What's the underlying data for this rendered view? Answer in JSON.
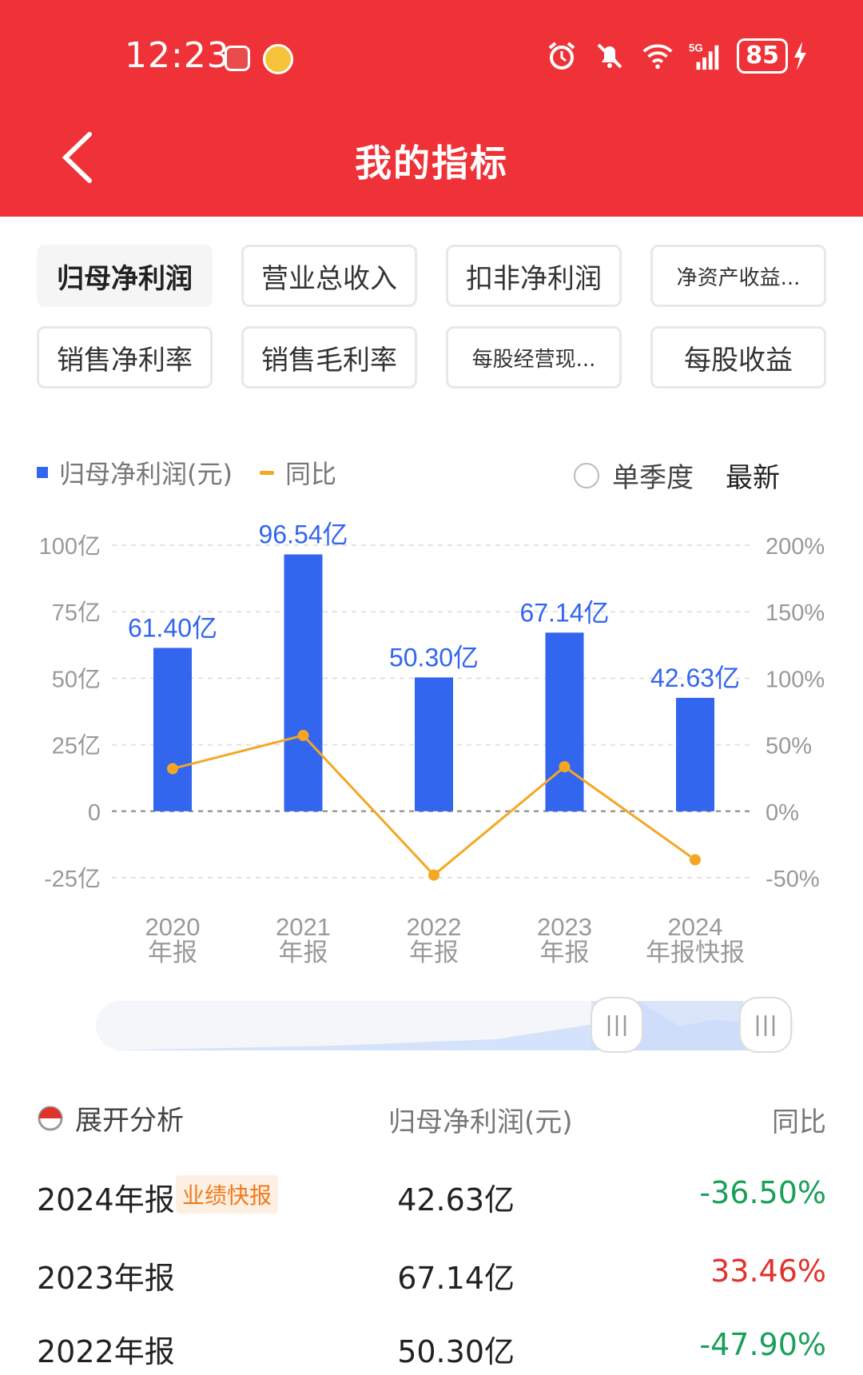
{
  "status_bar": {
    "time": "12:23",
    "battery": "85"
  },
  "header": {
    "title": "我的指标"
  },
  "metric_chips": [
    {
      "label": "归母净利润",
      "active": true
    },
    {
      "label": "营业总收入",
      "active": false
    },
    {
      "label": "扣非净利润",
      "active": false
    },
    {
      "label": "净资产收益...",
      "active": false
    },
    {
      "label": "销售净利率",
      "active": false
    },
    {
      "label": "销售毛利率",
      "active": false
    },
    {
      "label": "每股经营现...",
      "active": false
    },
    {
      "label": "每股收益",
      "active": false
    }
  ],
  "legend": {
    "series1": "归母净利润(元)",
    "series2": "同比"
  },
  "controls": {
    "single_quarter": "单季度",
    "latest": "最新"
  },
  "chart_data": {
    "type": "bar",
    "categories": [
      "2020\n年报",
      "2021\n年报",
      "2022\n年报",
      "2023\n年报",
      "2024\n年报快报"
    ],
    "series": [
      {
        "name": "归母净利润(元)",
        "type": "bar",
        "values": [
          61.4,
          96.54,
          50.3,
          67.14,
          42.63
        ],
        "labels": [
          "61.40亿",
          "96.54亿",
          "50.30亿",
          "67.14亿",
          "42.63亿"
        ],
        "unit": "亿",
        "color": "#3366ee"
      },
      {
        "name": "同比",
        "type": "line",
        "values": [
          32,
          57,
          -48,
          33.46,
          -36.5
        ],
        "unit": "%",
        "color": "#f5a623"
      }
    ],
    "y_left": {
      "ticks": [
        "100亿",
        "75亿",
        "50亿",
        "25亿",
        "0",
        "-25亿"
      ],
      "range": [
        -25,
        100
      ]
    },
    "y_right": {
      "ticks": [
        "200%",
        "150%",
        "100%",
        "50%",
        "0%",
        "-50%"
      ],
      "range": [
        -50,
        200
      ]
    },
    "grid": true
  },
  "analysis": {
    "label": "展开分析",
    "col_value": "归母净利润(元)",
    "col_yoy": "同比"
  },
  "rows": [
    {
      "year": "2024年报",
      "badge": "业绩快报",
      "value": "42.63亿",
      "yoy": "-36.50%"
    },
    {
      "year": "2023年报",
      "badge": "",
      "value": "67.14亿",
      "yoy": "33.46%"
    },
    {
      "year": "2022年报",
      "badge": "",
      "value": "50.30亿",
      "yoy": "-47.90%"
    }
  ],
  "colors": {
    "header_red": "#ee3237",
    "bar_blue": "#3366ee",
    "line_orange": "#f5a623",
    "negative_green": "#1aa05a",
    "positive_red": "#e0332c"
  }
}
